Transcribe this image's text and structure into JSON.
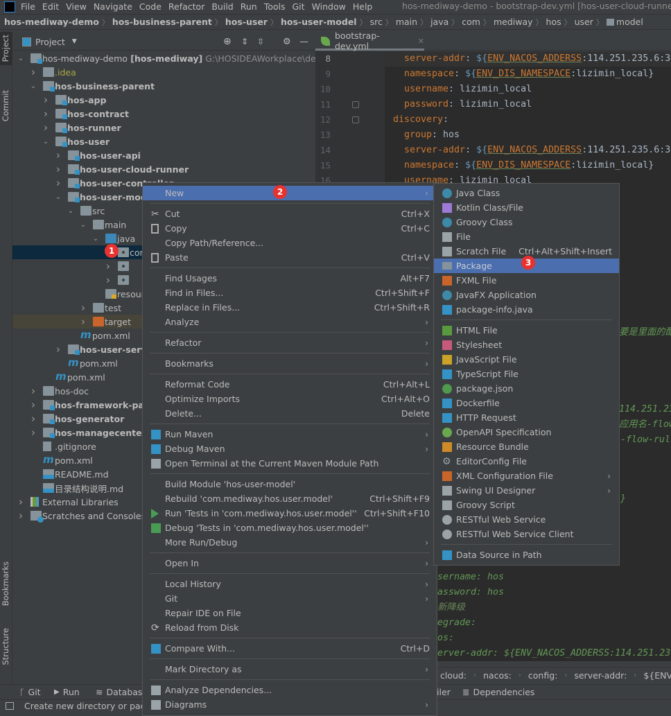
{
  "menubar": {
    "items": [
      "File",
      "Edit",
      "View",
      "Navigate",
      "Code",
      "Refactor",
      "Build",
      "Run",
      "Tools",
      "Git",
      "Window",
      "Help"
    ],
    "window_title": "hos-mediway-demo - bootstrap-dev.yml [hos-user-cloud-runner] -"
  },
  "navbar": {
    "crumbs": [
      {
        "label": "hos-mediway-demo",
        "bold": true
      },
      {
        "label": "hos-business-parent",
        "bold": true
      },
      {
        "label": "hos-user",
        "bold": true
      },
      {
        "label": "hos-user-model",
        "bold": true
      },
      {
        "label": "src"
      },
      {
        "label": "main"
      },
      {
        "label": "java"
      },
      {
        "label": "com"
      },
      {
        "label": "mediway"
      },
      {
        "label": "hos"
      },
      {
        "label": "user"
      },
      {
        "label": "model",
        "icon": "package-icon"
      }
    ]
  },
  "left_strip": {
    "project": "Project",
    "commit": "Commit",
    "bookmarks": "Bookmarks",
    "structure": "Structure"
  },
  "project_panel": {
    "title": "Project",
    "tree": [
      {
        "level": 0,
        "arrow": "open",
        "icon": "module",
        "label": "hos-mediway-demo",
        "extra": "[hos-mediway]",
        "path": "G:\\HOSIDEAWorkplace\\demo\\"
      },
      {
        "level": 1,
        "arrow": "closed",
        "icon": "folder",
        "label": ".idea",
        "color": "#a7a742"
      },
      {
        "level": 1,
        "arrow": "open",
        "icon": "module",
        "label": "hos-business-parent",
        "bold": true
      },
      {
        "level": 2,
        "arrow": "closed",
        "icon": "module",
        "label": "hos-app",
        "bold": true
      },
      {
        "level": 2,
        "arrow": "closed",
        "icon": "module",
        "label": "hos-contract",
        "bold": true
      },
      {
        "level": 2,
        "arrow": "closed",
        "icon": "module",
        "label": "hos-runner",
        "bold": true
      },
      {
        "level": 2,
        "arrow": "open",
        "icon": "module",
        "label": "hos-user",
        "bold": true
      },
      {
        "level": 3,
        "arrow": "closed",
        "icon": "module",
        "label": "hos-user-api",
        "bold": true
      },
      {
        "level": 3,
        "arrow": "closed",
        "icon": "module",
        "label": "hos-user-cloud-runner",
        "bold": true
      },
      {
        "level": 3,
        "arrow": "closed",
        "icon": "module",
        "label": "hos-user-controller",
        "bold": true
      },
      {
        "level": 3,
        "arrow": "open",
        "icon": "module",
        "label": "hos-user-model",
        "bold": true
      },
      {
        "level": 4,
        "arrow": "open",
        "icon": "folder",
        "label": "src"
      },
      {
        "level": 5,
        "arrow": "open",
        "icon": "folder",
        "label": "main"
      },
      {
        "level": 6,
        "arrow": "open",
        "icon": "source-folder",
        "label": "java"
      },
      {
        "level": 7,
        "arrow": "none",
        "icon": "package",
        "label": "com",
        "selected": true
      },
      {
        "level": 7,
        "arrow": "closed",
        "icon": "package",
        "label": ""
      },
      {
        "level": 7,
        "arrow": "closed",
        "icon": "package",
        "label": ""
      },
      {
        "level": 6,
        "arrow": "none",
        "icon": "resources-folder",
        "label": "resources"
      },
      {
        "level": 5,
        "arrow": "closed",
        "icon": "folder",
        "label": "test"
      },
      {
        "level": 5,
        "arrow": "closed",
        "icon": "excluded-folder",
        "label": "target",
        "excluded": true
      },
      {
        "level": 4,
        "arrow": "none",
        "icon": "maven",
        "label": "pom.xml"
      },
      {
        "level": 3,
        "arrow": "closed",
        "icon": "module",
        "label": "hos-user-service",
        "bold": true
      },
      {
        "level": 3,
        "arrow": "none",
        "icon": "maven",
        "label": "pom.xml"
      },
      {
        "level": 2,
        "arrow": "none",
        "icon": "maven",
        "label": "pom.xml"
      },
      {
        "level": 1,
        "arrow": "closed",
        "icon": "folder",
        "label": "hos-doc"
      },
      {
        "level": 1,
        "arrow": "closed",
        "icon": "module",
        "label": "hos-framework-parent",
        "bold": true
      },
      {
        "level": 1,
        "arrow": "closed",
        "icon": "module",
        "label": "hos-generator",
        "bold": true
      },
      {
        "level": 1,
        "arrow": "closed",
        "icon": "module",
        "label": "hos-managecenter",
        "bold": true
      },
      {
        "level": 1,
        "arrow": "none",
        "icon": "gitignore",
        "label": ".gitignore"
      },
      {
        "level": 1,
        "arrow": "none",
        "icon": "maven",
        "label": "pom.xml"
      },
      {
        "level": 1,
        "arrow": "none",
        "icon": "markdown",
        "label": "README.md"
      },
      {
        "level": 1,
        "arrow": "none",
        "icon": "markdown",
        "label": "目录结构说明.md"
      },
      {
        "level": 0,
        "arrow": "closed",
        "icon": "libraries",
        "label": "External Libraries"
      },
      {
        "level": 0,
        "arrow": "closed",
        "icon": "scratches",
        "label": "Scratches and Consoles"
      }
    ]
  },
  "editor": {
    "tab": "bootstrap-dev.yml",
    "lines": [
      {
        "n": "8",
        "indent": 4,
        "parts": [
          [
            "k",
            "server-addr"
          ],
          [
            "v",
            ": "
          ],
          [
            "d",
            "${"
          ],
          [
            "env",
            "ENV_NACOS_ADDERSS"
          ],
          [
            "v",
            ":114.251.235.6:3"
          ]
        ]
      },
      {
        "n": "9",
        "indent": 4,
        "parts": [
          [
            "k",
            "namespace"
          ],
          [
            "v",
            ": "
          ],
          [
            "d",
            "${"
          ],
          [
            "env",
            "ENV_DIS_NAMESPACE"
          ],
          [
            "v",
            ":lizimin_local}"
          ]
        ]
      },
      {
        "n": "10",
        "indent": 4,
        "parts": [
          [
            "k",
            "username"
          ],
          [
            "v",
            ": lizimin_local"
          ]
        ]
      },
      {
        "n": "11",
        "indent": 4,
        "parts": [
          [
            "k",
            "password"
          ],
          [
            "v",
            ": lizimin_local"
          ]
        ]
      },
      {
        "n": "12",
        "indent": 2,
        "parts": [
          [
            "k",
            "discovery"
          ],
          [
            "v",
            ":"
          ]
        ]
      },
      {
        "n": "13",
        "indent": 4,
        "parts": [
          [
            "k",
            "group"
          ],
          [
            "v",
            ": hos"
          ]
        ]
      },
      {
        "n": "14",
        "indent": 4,
        "parts": [
          [
            "k",
            "server-addr"
          ],
          [
            "v",
            ": "
          ],
          [
            "d",
            "${"
          ],
          [
            "env",
            "ENV_NACOS_ADDERSS"
          ],
          [
            "v",
            ":114.251.235.6:3"
          ]
        ]
      },
      {
        "n": "15",
        "indent": 4,
        "parts": [
          [
            "k",
            "namespace"
          ],
          [
            "v",
            ": "
          ],
          [
            "d",
            "${"
          ],
          [
            "env",
            "ENV_DIS_NAMESPACE"
          ],
          [
            "v",
            ":lizimin_local}"
          ]
        ]
      },
      {
        "n": "16",
        "indent": 4,
        "parts": [
          [
            "k",
            "username"
          ],
          [
            "v",
            ": lizimin_local"
          ]
        ]
      }
    ],
    "fragments_right": [
      "要是里面的配",
      "114.251.23",
      "应用名-flow",
      "-flow-rul",
      "}"
    ],
    "fragments_bottom": [
      "sername: hos",
      "assword: hos",
      "新降级",
      "egrade:",
      "os:",
      "erver-addr: ${ENV_NACOS_ADDERSS:114.251.23"
    ],
    "breadcrumbs": [
      "cloud:",
      "nacos:",
      "config:",
      "server-addr:",
      "${ENV_NA"
    ]
  },
  "context_menu": [
    {
      "label": "New",
      "submenu": true,
      "highlight": true
    },
    {
      "sep": true
    },
    {
      "label": "Cut",
      "shortcut": "Ctrl+X",
      "icon": "scissors-icon"
    },
    {
      "label": "Copy",
      "shortcut": "Ctrl+C",
      "icon": "copy-icon"
    },
    {
      "label": "Copy Path/Reference..."
    },
    {
      "label": "Paste",
      "shortcut": "Ctrl+V",
      "icon": "paste-icon"
    },
    {
      "sep": true
    },
    {
      "label": "Find Usages",
      "shortcut": "Alt+F7"
    },
    {
      "label": "Find in Files...",
      "shortcut": "Ctrl+Shift+F"
    },
    {
      "label": "Replace in Files...",
      "shortcut": "Ctrl+Shift+R"
    },
    {
      "label": "Analyze",
      "submenu": true
    },
    {
      "sep": true
    },
    {
      "label": "Refactor",
      "submenu": true
    },
    {
      "sep": true
    },
    {
      "label": "Bookmarks",
      "submenu": true
    },
    {
      "sep": true
    },
    {
      "label": "Reformat Code",
      "shortcut": "Ctrl+Alt+L"
    },
    {
      "label": "Optimize Imports",
      "shortcut": "Ctrl+Alt+O"
    },
    {
      "label": "Delete...",
      "shortcut": "Delete"
    },
    {
      "sep": true
    },
    {
      "label": "Run Maven",
      "submenu": true,
      "icon": "run-maven-icon"
    },
    {
      "label": "Debug Maven",
      "submenu": true,
      "icon": "debug-maven-icon"
    },
    {
      "label": "Open Terminal at the Current Maven Module Path",
      "icon": "terminal-maven-icon"
    },
    {
      "sep": true
    },
    {
      "label": "Build Module 'hos-user-model'"
    },
    {
      "label": "Rebuild 'com.mediway.hos.user.model'",
      "shortcut": "Ctrl+Shift+F9"
    },
    {
      "label": "Run 'Tests in 'com.mediway.hos.user.model''",
      "shortcut": "Ctrl+Shift+F10",
      "icon": "run-icon"
    },
    {
      "label": "Debug 'Tests in 'com.mediway.hos.user.model''",
      "icon": "debug-icon"
    },
    {
      "label": "More Run/Debug",
      "submenu": true
    },
    {
      "sep": true
    },
    {
      "label": "Open In",
      "submenu": true
    },
    {
      "sep": true
    },
    {
      "label": "Local History",
      "submenu": true
    },
    {
      "label": "Git",
      "submenu": true
    },
    {
      "label": "Repair IDE on File"
    },
    {
      "label": "Reload from Disk",
      "icon": "reload-icon"
    },
    {
      "sep": true
    },
    {
      "label": "Compare With...",
      "shortcut": "Ctrl+D",
      "icon": "compare-icon"
    },
    {
      "sep": true
    },
    {
      "label": "Mark Directory as",
      "submenu": true
    },
    {
      "sep": true
    },
    {
      "label": "Analyze Dependencies...",
      "icon": "dependencies-icon"
    },
    {
      "label": "Diagrams",
      "submenu": true,
      "icon": "diagram-icon"
    }
  ],
  "new_submenu": [
    {
      "label": "Java Class",
      "icon": "java-class-icon"
    },
    {
      "label": "Kotlin Class/File",
      "icon": "kotlin-file-icon"
    },
    {
      "label": "Groovy Class",
      "icon": "groovy-class-icon"
    },
    {
      "label": "File",
      "icon": "file-icon"
    },
    {
      "label": "Scratch File",
      "shortcut": "Ctrl+Alt+Shift+Insert",
      "icon": "scratch-file-icon"
    },
    {
      "label": "Package",
      "icon": "package-icon",
      "highlight": true
    },
    {
      "label": "FXML File",
      "icon": "fxml-file-icon"
    },
    {
      "label": "JavaFX Application",
      "icon": "javafx-icon"
    },
    {
      "label": "package-info.java",
      "icon": "java-file-icon"
    },
    {
      "sep": true
    },
    {
      "label": "HTML File",
      "icon": "html-file-icon"
    },
    {
      "label": "Stylesheet",
      "icon": "css-file-icon"
    },
    {
      "label": "JavaScript File",
      "icon": "js-file-icon"
    },
    {
      "label": "TypeScript File",
      "icon": "ts-file-icon"
    },
    {
      "label": "package.json",
      "icon": "nodejs-icon"
    },
    {
      "label": "Dockerfile",
      "icon": "docker-file-icon"
    },
    {
      "label": "HTTP Request",
      "icon": "http-request-icon"
    },
    {
      "label": "OpenAPI Specification",
      "icon": "openapi-icon"
    },
    {
      "label": "Resource Bundle",
      "icon": "resource-bundle-icon"
    },
    {
      "label": "EditorConfig File",
      "icon": "gear-icon"
    },
    {
      "label": "XML Configuration File",
      "icon": "xml-file-icon",
      "submenu": true
    },
    {
      "label": "Swing UI Designer",
      "icon": "swing-icon",
      "submenu": true
    },
    {
      "label": "Groovy Script",
      "icon": "groovy-script-icon"
    },
    {
      "label": "RESTful Web Service",
      "icon": "globe-icon"
    },
    {
      "label": "RESTful Web Service Client",
      "icon": "globe-client-icon"
    },
    {
      "sep": true
    },
    {
      "label": "Data Source in Path",
      "icon": "database-icon"
    }
  ],
  "badges": [
    "1",
    "2",
    "3"
  ],
  "bottom_toolbar": {
    "git": "Git",
    "run": "Run",
    "database": "Database",
    "profiler": "iler",
    "dependencies": "Dependencies"
  },
  "status": "Create new directory or pack",
  "colors": {
    "menu_bg": "#3c3f41",
    "highlight": "#4b6eaf",
    "editor_bg": "#2b2b2b",
    "badge": "#e8322f",
    "yaml_key": "#cc7832",
    "comment": "#629755"
  }
}
